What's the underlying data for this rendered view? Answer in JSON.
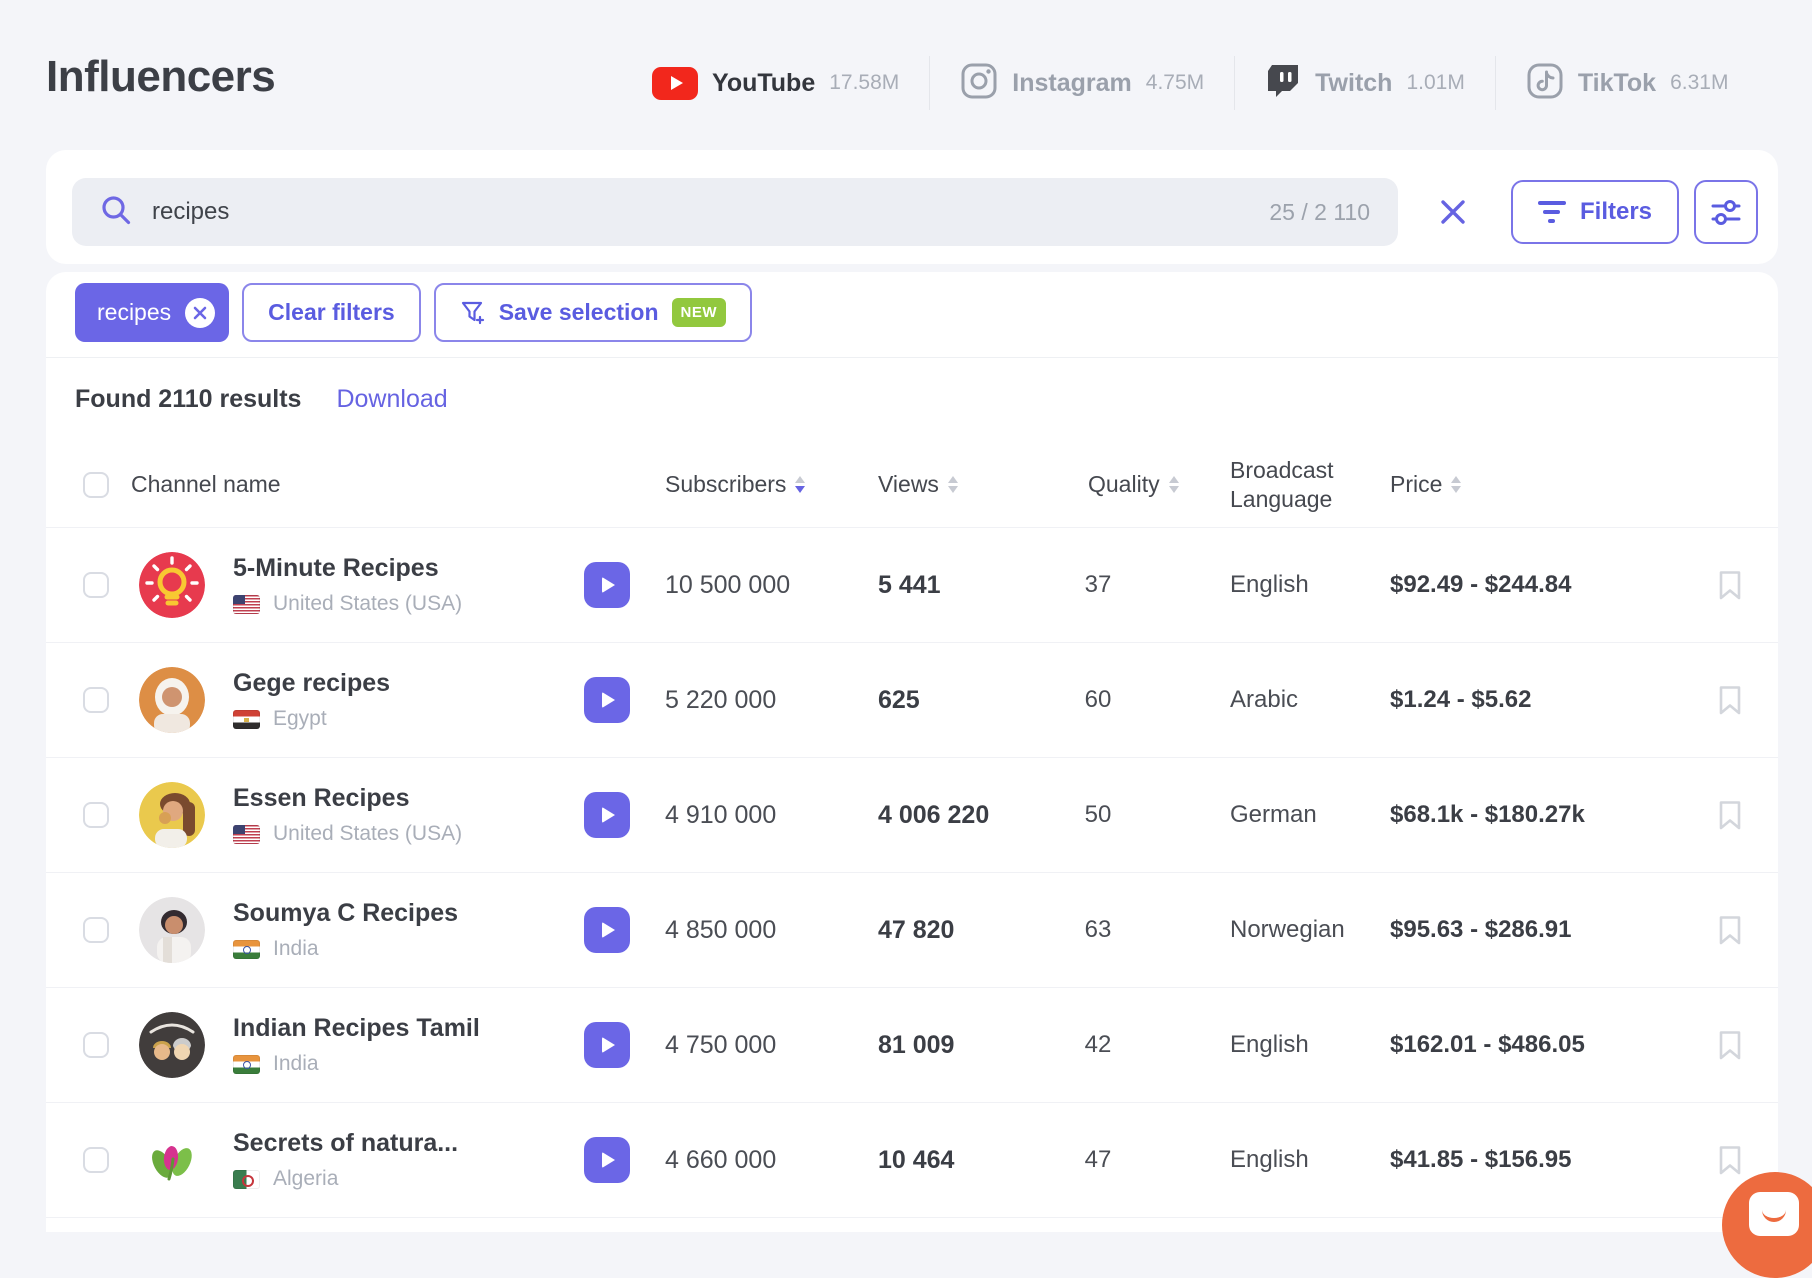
{
  "header": {
    "title": "Influencers",
    "platforms": [
      {
        "name": "YouTube",
        "count": "17.58M",
        "active": true
      },
      {
        "name": "Instagram",
        "count": "4.75M",
        "active": false
      },
      {
        "name": "Twitch",
        "count": "1.01M",
        "active": false
      },
      {
        "name": "TikTok",
        "count": "6.31M",
        "active": false
      }
    ]
  },
  "search": {
    "query": "recipes",
    "counter": "25 / 2 110",
    "filters_label": "Filters"
  },
  "filters": {
    "chip_label": "recipes",
    "clear_label": "Clear filters",
    "save_label": "Save selection",
    "new_badge": "NEW"
  },
  "results": {
    "found_text": "Found 2110 results",
    "download_label": "Download"
  },
  "table": {
    "columns": {
      "channel": "Channel name",
      "subscribers": "Subscribers",
      "views": "Views",
      "quality": "Quality",
      "language": "Broadcast Language",
      "price": "Price"
    },
    "sort_state": {
      "subscribers": "desc"
    },
    "rows": [
      {
        "name": "5-Minute Recipes",
        "country": "United States (USA)",
        "flag_class": "flag flag-us",
        "subscribers": "10 500 000",
        "views": "5 441",
        "quality": "37",
        "language": "English",
        "price": "$92.49 - $244.84"
      },
      {
        "name": "Gege recipes",
        "country": "Egypt",
        "flag_class": "flag flag-eg",
        "subscribers": "5 220 000",
        "views": "625",
        "quality": "60",
        "language": "Arabic",
        "price": "$1.24 - $5.62"
      },
      {
        "name": "Essen Recipes",
        "country": "United States (USA)",
        "flag_class": "flag flag-us",
        "subscribers": "4 910 000",
        "views": "4 006 220",
        "quality": "50",
        "language": "German",
        "price": "$68.1k - $180.27k"
      },
      {
        "name": "Soumya C Recipes",
        "country": "India",
        "flag_class": "flag flag-in",
        "subscribers": "4 850 000",
        "views": "47 820",
        "quality": "63",
        "language": "Norwegian",
        "price": "$95.63 - $286.91"
      },
      {
        "name": "Indian Recipes Tamil",
        "country": "India",
        "flag_class": "flag flag-in",
        "subscribers": "4 750 000",
        "views": "81 009",
        "quality": "42",
        "language": "English",
        "price": "$162.01 - $486.05"
      },
      {
        "name": "Secrets of natura...",
        "country": "Algeria",
        "flag_class": "flag flag-dz",
        "subscribers": "4 660 000",
        "views": "10 464",
        "quality": "47",
        "language": "English",
        "price": "$41.85 - $156.95"
      }
    ]
  },
  "icons": {
    "search": "magnifier",
    "clear_search": "x-mark",
    "filters": "filter-bars",
    "settings": "sliders",
    "save_selection": "funnel-plus",
    "sort": "up-down-triangles",
    "play": "youtube-play-triangle",
    "bookmark": "ribbon-outline",
    "chat": "smile-chat-bubble"
  },
  "colors": {
    "accent_purple": "#6663e2",
    "chip_purple": "#6b66e6",
    "youtube_red": "#f2271c",
    "new_badge_green": "#92c83e",
    "chat_orange": "#ed6b3f",
    "page_background": "#f4f5f9"
  }
}
